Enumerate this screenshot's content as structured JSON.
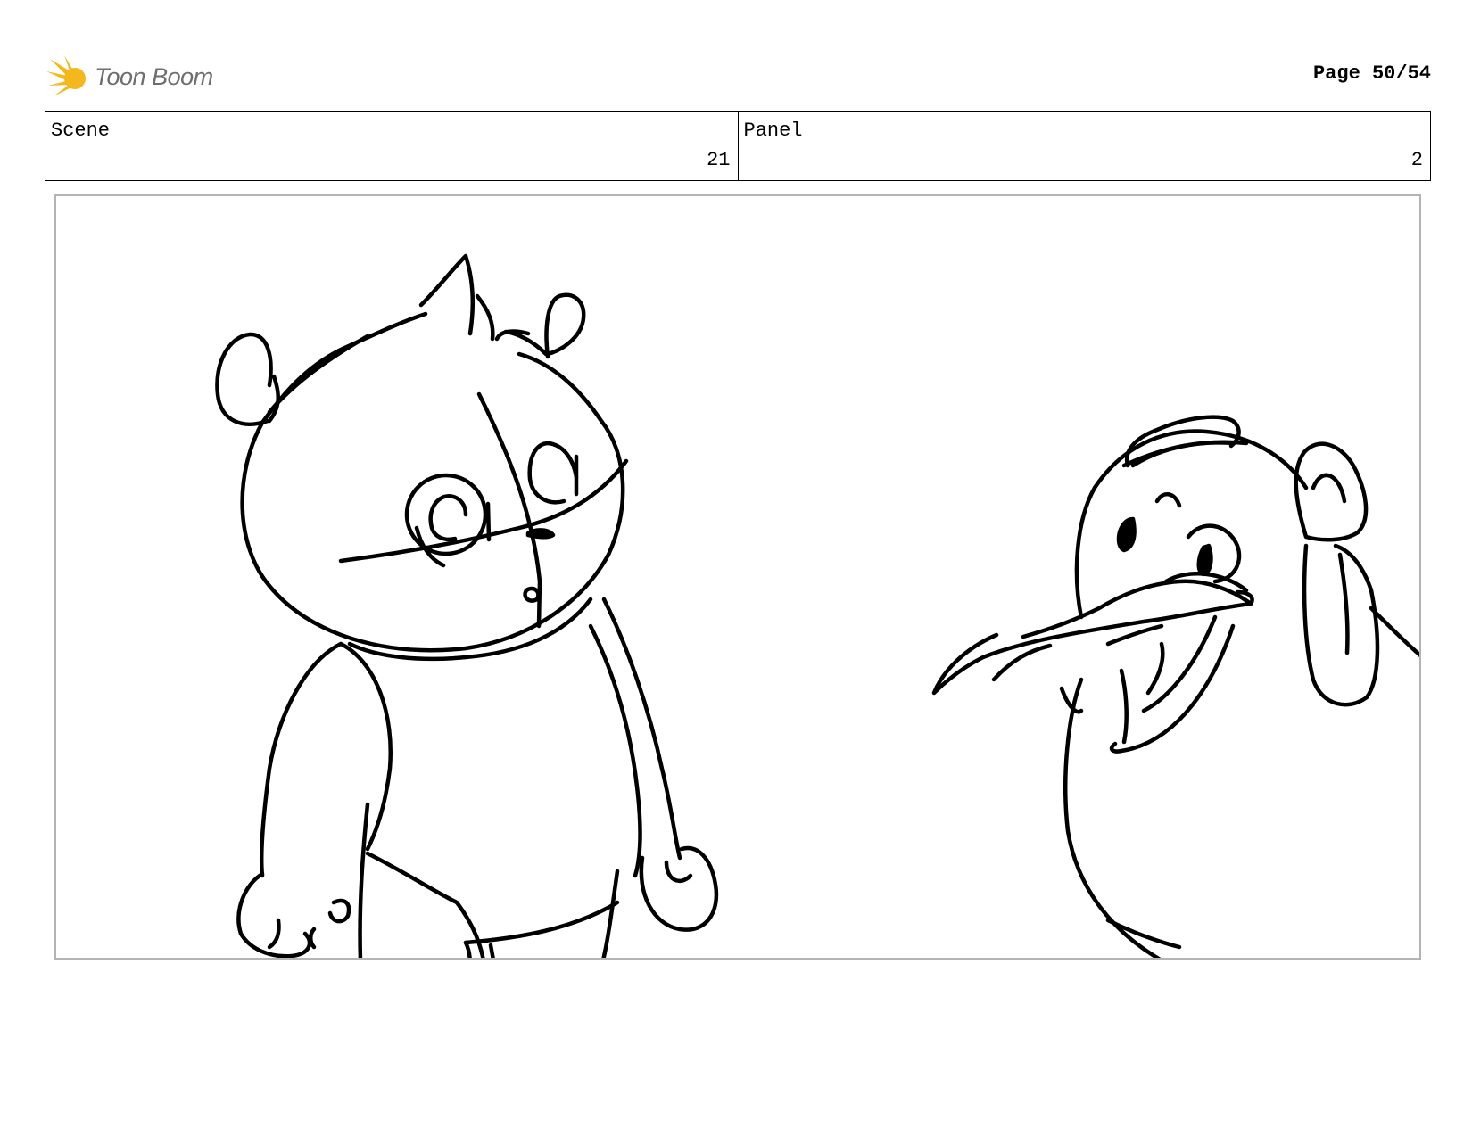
{
  "header": {
    "logo_text": "Toon Boom",
    "logo_color": "#f5b81c",
    "page_label": "Page 50/54"
  },
  "info": {
    "scene_label": "Scene",
    "scene_value": "21",
    "panel_label": "Panel",
    "panel_value": "2"
  },
  "panel_image": {
    "content": "storyboard-sketch"
  }
}
